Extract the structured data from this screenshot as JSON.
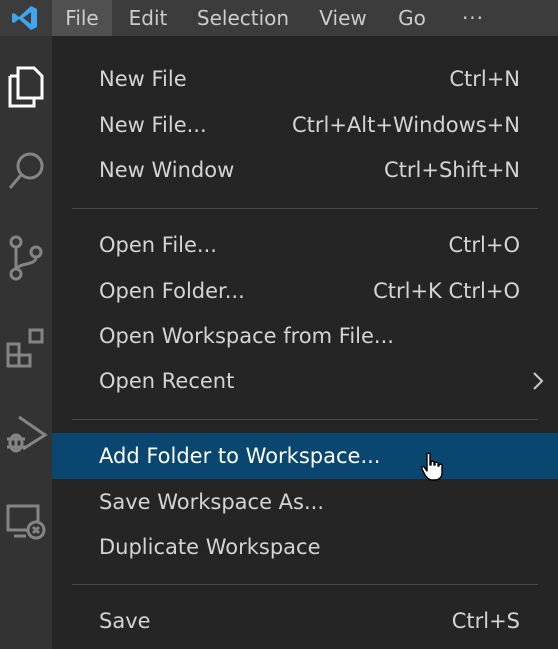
{
  "menubar": {
    "items": [
      "File",
      "Edit",
      "Selection",
      "View",
      "Go",
      "···"
    ],
    "active": "File"
  },
  "activitybar": {
    "icons": [
      "explorer-icon",
      "search-icon",
      "source-control-icon",
      "extensions-icon",
      "run-debug-icon",
      "remote-explorer-icon"
    ]
  },
  "file_menu": {
    "groups": [
      [
        {
          "label": "New File",
          "shortcut": "Ctrl+N"
        },
        {
          "label": "New File...",
          "shortcut": "Ctrl+Alt+Windows+N"
        },
        {
          "label": "New Window",
          "shortcut": "Ctrl+Shift+N"
        }
      ],
      [
        {
          "label": "Open File...",
          "shortcut": "Ctrl+O"
        },
        {
          "label": "Open Folder...",
          "shortcut": "Ctrl+K Ctrl+O"
        },
        {
          "label": "Open Workspace from File...",
          "shortcut": ""
        },
        {
          "label": "Open Recent",
          "shortcut": "",
          "submenu": true
        }
      ],
      [
        {
          "label": "Add Folder to Workspace...",
          "shortcut": "",
          "highlighted": true
        },
        {
          "label": "Save Workspace As...",
          "shortcut": ""
        },
        {
          "label": "Duplicate Workspace",
          "shortcut": ""
        }
      ],
      [
        {
          "label": "Save",
          "shortcut": "Ctrl+S"
        }
      ]
    ]
  },
  "colors": {
    "menubar_bg": "#3c3c3c",
    "activitybar_bg": "#333333",
    "menu_bg": "#252526",
    "highlight_bg": "#094771",
    "text": "#d4d4d4",
    "logo": "#3ea6f0"
  }
}
